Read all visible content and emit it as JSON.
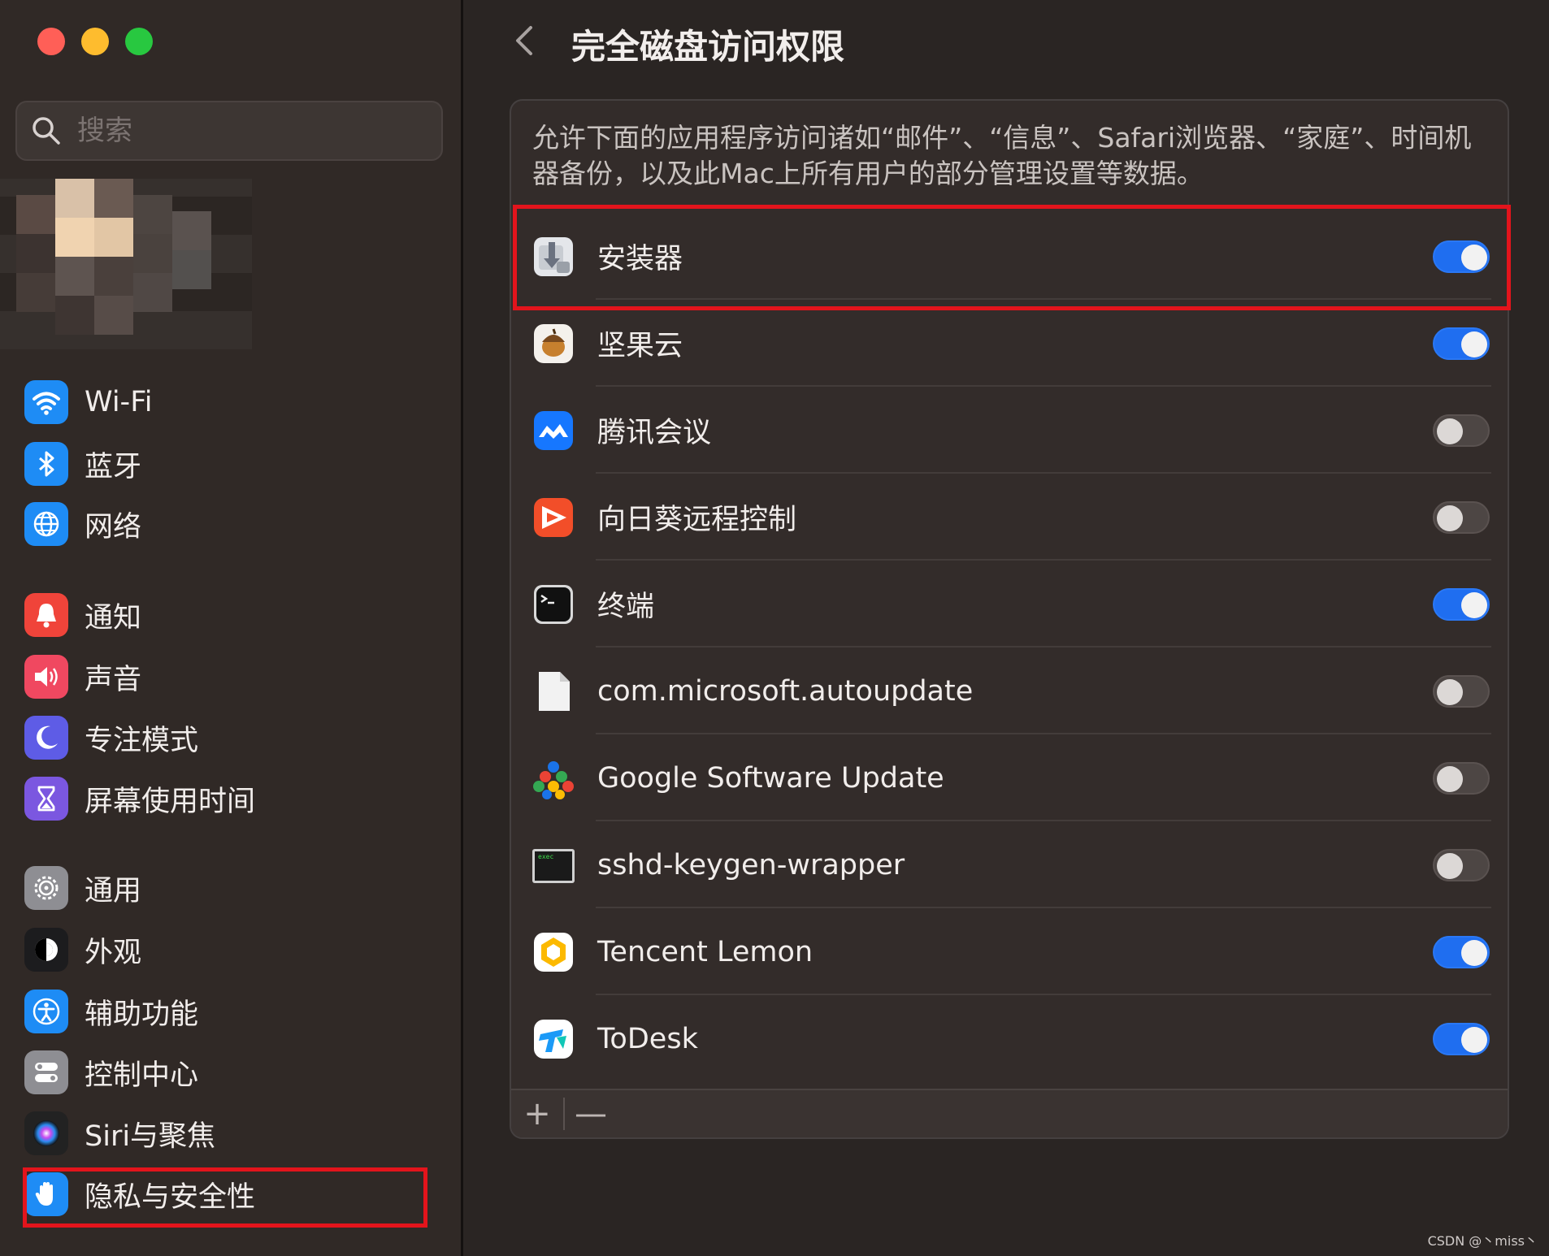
{
  "window": {
    "traffic_lights": [
      "close",
      "minimize",
      "zoom"
    ]
  },
  "search": {
    "placeholder": "搜索"
  },
  "sidebar": {
    "items": [
      {
        "label": "Wi-Fi",
        "icon": "wifi-icon",
        "color": "#1e8cf5"
      },
      {
        "label": "蓝牙",
        "icon": "bluetooth-icon",
        "color": "#1e8cf5"
      },
      {
        "label": "网络",
        "icon": "globe-icon",
        "color": "#1e8cf5"
      },
      {
        "label": "通知",
        "icon": "bell-icon",
        "color": "#f0443a"
      },
      {
        "label": "声音",
        "icon": "speaker-icon",
        "color": "#f04860"
      },
      {
        "label": "专注模式",
        "icon": "moon-icon",
        "color": "#5e5ce6"
      },
      {
        "label": "屏幕使用时间",
        "icon": "hourglass-icon",
        "color": "#7b57e0"
      },
      {
        "label": "通用",
        "icon": "gear-icon",
        "color": "#8e8e93"
      },
      {
        "label": "外观",
        "icon": "appearance-icon",
        "color": "#1c1c1e"
      },
      {
        "label": "辅助功能",
        "icon": "accessibility-icon",
        "color": "#1e8cf5"
      },
      {
        "label": "控制中心",
        "icon": "control-center-icon",
        "color": "#8e8e93"
      },
      {
        "label": "Siri与聚焦",
        "icon": "siri-icon",
        "color": "#222"
      },
      {
        "label": "隐私与安全性",
        "icon": "hand-icon",
        "color": "#1e8cf5",
        "selected": true
      }
    ]
  },
  "main": {
    "title": "完全磁盘访问权限",
    "description": "允许下面的应用程序访问诸如“邮件”、“信息”、Safari浏览器、“家庭”、时间机器备份，以及此Mac上所有用户的部分管理设置等数据。",
    "apps": [
      {
        "name": "安装器",
        "icon": "installer-icon",
        "enabled": true
      },
      {
        "name": "坚果云",
        "icon": "jianguoyun-icon",
        "enabled": true
      },
      {
        "name": "腾讯会议",
        "icon": "tencent-meeting-icon",
        "enabled": false
      },
      {
        "name": "向日葵远程控制",
        "icon": "sunlogin-icon",
        "enabled": false
      },
      {
        "name": "终端",
        "icon": "terminal-icon",
        "enabled": true
      },
      {
        "name": "com.microsoft.autoupdate",
        "icon": "document-icon",
        "enabled": false
      },
      {
        "name": "Google Software Update",
        "icon": "google-update-icon",
        "enabled": false
      },
      {
        "name": "sshd-keygen-wrapper",
        "icon": "exec-icon",
        "enabled": false
      },
      {
        "name": "Tencent Lemon",
        "icon": "tencent-lemon-icon",
        "enabled": true
      },
      {
        "name": "ToDesk",
        "icon": "todesk-icon",
        "enabled": true
      }
    ],
    "footer": {
      "add_label": "+",
      "remove_label": "—"
    }
  },
  "watermark": "CSDN @丶miss丶"
}
